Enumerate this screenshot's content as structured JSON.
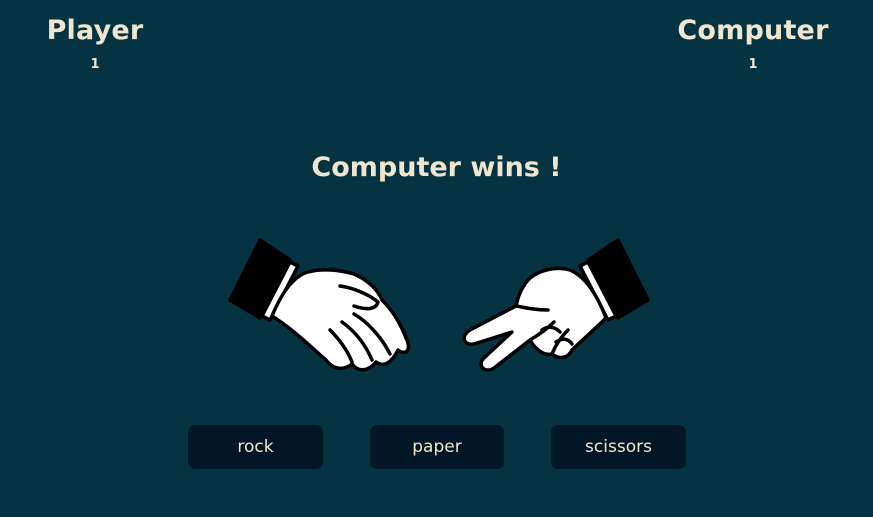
{
  "scoreboard": {
    "player": {
      "name": "Player",
      "score": "1"
    },
    "computer": {
      "name": "Computer",
      "score": "1"
    }
  },
  "result_text": "Computer wins !",
  "hands": {
    "player": {
      "icon": "paper-hand-icon"
    },
    "computer": {
      "icon": "scissors-hand-icon"
    }
  },
  "choices": [
    {
      "label": "rock"
    },
    {
      "label": "paper"
    },
    {
      "label": "scissors"
    }
  ],
  "colors": {
    "background": "#053342",
    "text": "#efe6d0",
    "button_bg": "#021626",
    "hand_fill": "#ffffff",
    "hand_outline": "#000000"
  }
}
